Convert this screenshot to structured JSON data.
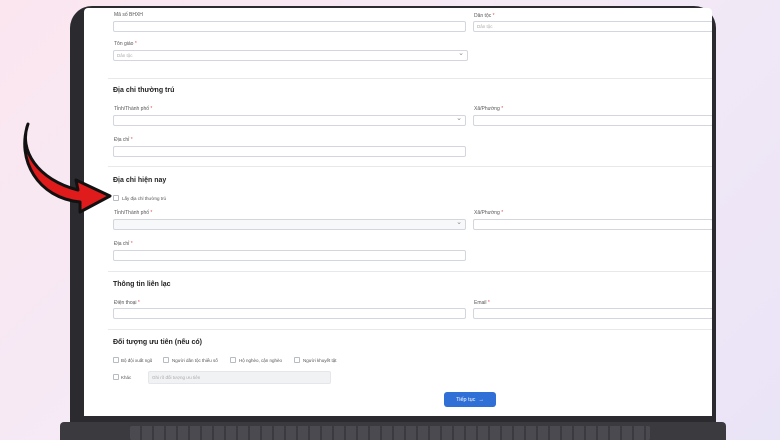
{
  "top": {
    "code_label": "Mã số BHXH",
    "ethnic_label": "Dân tộc",
    "ethnic_placeholder": "Dân tộc",
    "religion_label": "Tôn giáo",
    "religion_placeholder": "Dân tộc"
  },
  "permanent": {
    "title": "Địa chỉ thường trú",
    "province_label": "Tỉnh/Thành phố",
    "ward_label": "Xã/Phường",
    "address_label": "Địa chỉ"
  },
  "current": {
    "title": "Địa chỉ hiện nay",
    "same_as_permanent": "Lấy địa chỉ thường trú",
    "province_label": "Tỉnh/Thành phố",
    "ward_label": "Xã/Phường",
    "address_label": "Địa chỉ"
  },
  "contact": {
    "title": "Thông tin liên lạc",
    "phone_label": "Điện thoại",
    "email_label": "Email"
  },
  "priority": {
    "title": "Đối tượng ưu tiên (nếu có)",
    "options": [
      "Bộ đội xuất ngũ",
      "Người dân tộc thiểu số",
      "Hộ nghèo, cận nghèo",
      "Người khuyết tật"
    ],
    "other_label": "Khác",
    "other_placeholder": "Ghi rõ đối tượng ưu tiên"
  },
  "required_mark": "*",
  "next_button": {
    "label": "Tiếp tục",
    "icon": "→"
  },
  "colors": {
    "accent": "#2f6fd6",
    "arrow": "#e01b1b",
    "required": "#e05050"
  }
}
